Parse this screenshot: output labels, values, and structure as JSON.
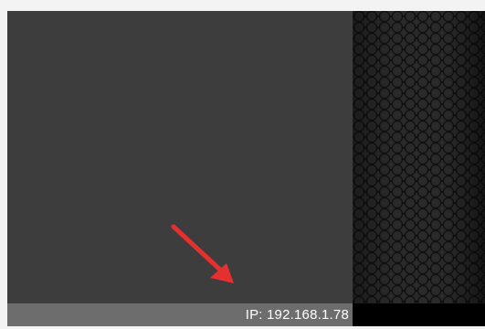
{
  "status_bar": {
    "ip_label": "IP: 192.168.1.78"
  },
  "icons": {
    "annotation_arrow": "red-arrow-icon"
  },
  "colors": {
    "panel": "#3d3d3d",
    "status_bar": "#6d6d6d",
    "arrow": "#e53030"
  }
}
